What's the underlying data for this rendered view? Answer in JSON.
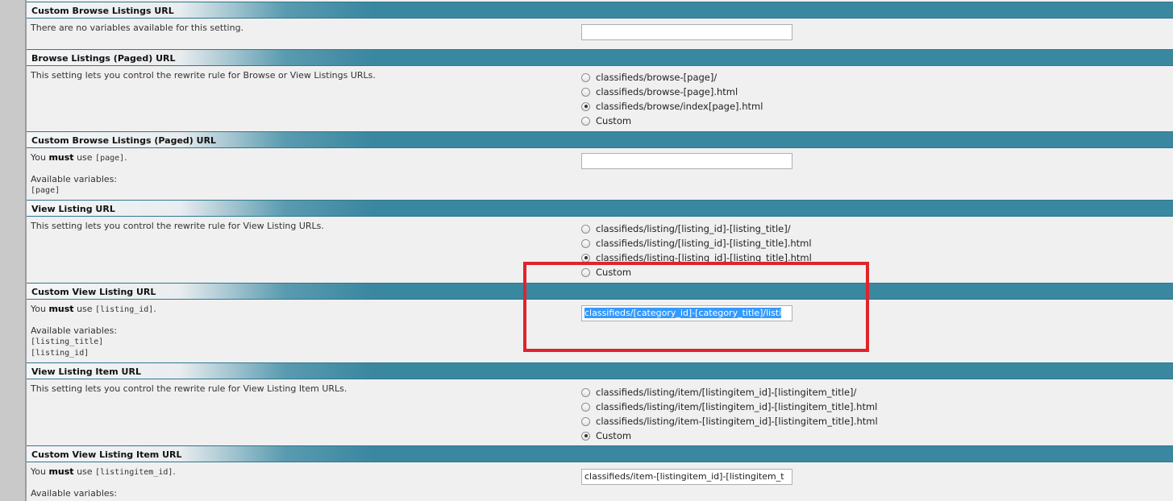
{
  "s1": {
    "title": "Custom Browse Listings URL",
    "desc": "There are no variables available for this setting.",
    "value": ""
  },
  "s2": {
    "title": "Browse Listings (Paged) URL",
    "desc": "This setting lets you control the rewrite rule for Browse or View Listings URLs.",
    "options": [
      "classifieds/browse-[page]/",
      "classifieds/browse-[page].html",
      "classifieds/browse/index[page].html",
      "Custom"
    ],
    "selected_index": 2
  },
  "s3": {
    "title": "Custom Browse Listings (Paged) URL",
    "must_prefix": "You ",
    "must_word": "must",
    "must_mid": " use ",
    "must_code": "[page]",
    "must_suffix": ".",
    "vars_label": "Available variables:",
    "vars": [
      "[page]"
    ],
    "value": ""
  },
  "s4": {
    "title": "View Listing URL",
    "desc": "This setting lets you control the rewrite rule for View Listing URLs.",
    "options": [
      "classifieds/listing/[listing_id]-[listing_title]/",
      "classifieds/listing/[listing_id]-[listing_title].html",
      "classifieds/listing-[listing_id]-[listing_title].html",
      "Custom"
    ],
    "selected_index": 2
  },
  "s5": {
    "title": "Custom View Listing URL",
    "must_prefix": "You ",
    "must_word": "must",
    "must_mid": " use ",
    "must_code": "[listing_id]",
    "must_suffix": ".",
    "vars_label": "Available variables:",
    "vars": [
      "[listing_title]",
      "[listing_id]"
    ],
    "value": "classifieds/[category_id]-[category_title]/listi"
  },
  "s6": {
    "title": "View Listing Item URL",
    "desc": "This setting lets you control the rewrite rule for View Listing Item URLs.",
    "options": [
      "classifieds/listing/item/[listingitem_id]-[listingitem_title]/",
      "classifieds/listing/item/[listingitem_id]-[listingitem_title].html",
      "classifieds/listing/item-[listingitem_id]-[listingitem_title].html",
      "Custom"
    ],
    "selected_index": 3
  },
  "s7": {
    "title": "Custom View Listing Item URL",
    "must_prefix": "You ",
    "must_word": "must",
    "must_mid": " use ",
    "must_code": "[listingitem_id]",
    "must_suffix": ".",
    "vars_label": "Available variables:",
    "value": "classifieds/item-[listingitem_id]-[listingitem_t"
  },
  "colors": {
    "header_blue": "#3a87a0",
    "highlight_red": "#e0242b",
    "selection_blue": "#3399ff"
  }
}
